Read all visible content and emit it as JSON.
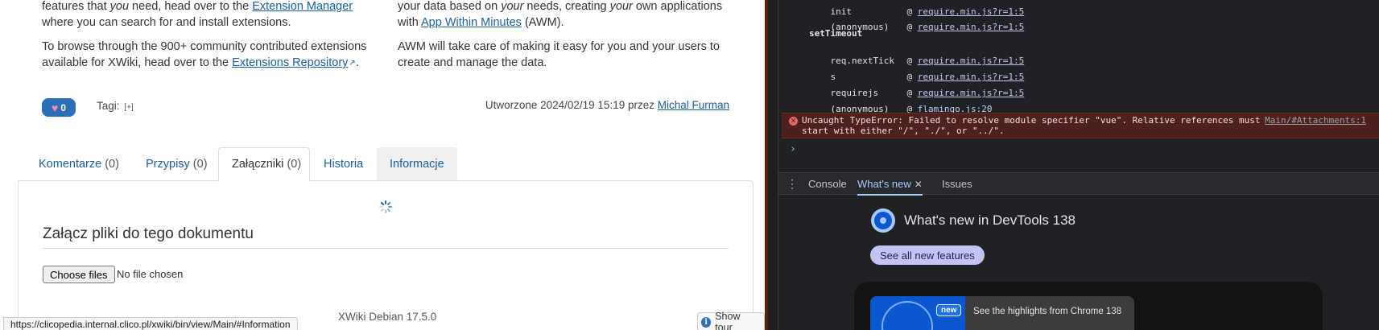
{
  "page": {
    "col_left": {
      "p1": {
        "pre": "features that ",
        "em": "you",
        "mid": " need, head over to the ",
        "link": "Extension Manager",
        "post": " where you can search for and install extensions."
      },
      "p2": {
        "pre": "To browse through the 900+ community contributed extensions available for XWiki, head over to the ",
        "link": "Extensions Repository",
        "post": "."
      }
    },
    "col_right": {
      "p1": {
        "pre": "your data based on ",
        "em": "your",
        "mid": " needs, creating ",
        "em2": "your",
        "mid2": " own applications with ",
        "link": "App Within Minutes",
        "post": " (AWM)."
      },
      "p2": "AWM will take care of making it easy for you and your users to create and manage the data."
    },
    "like_count": "0",
    "tags_label": "Tagi:",
    "tags_add": "[+]",
    "created": {
      "pre": "Utworzone 2024/02/19 15:19 przez ",
      "author": "Michal Furman"
    },
    "tabs": [
      {
        "label": "Komentarze",
        "count": "(0)"
      },
      {
        "label": "Przypisy",
        "count": "(0)"
      },
      {
        "label": "Załączniki",
        "count": "(0)"
      },
      {
        "label": "Historia",
        "count": ""
      },
      {
        "label": "Informacje",
        "count": ""
      }
    ],
    "attachments_title": "Załącz pliki do tego dokumentu",
    "choose_files": "Choose files",
    "no_file": "No file chosen",
    "footer_version": "XWiki Debian 17.5.0",
    "status_url": "https://clicopedia.internal.clico.pl/xwiki/bin/view/Main/#Information",
    "show_tour": "Show tour"
  },
  "devtools": {
    "stack_top": [
      {
        "fn": "init",
        "link": "require.min.js?r=1:5"
      },
      {
        "fn": "(anonymous)",
        "link": "require.min.js?r=1:5"
      }
    ],
    "async_label": "setTimeout",
    "stack_bottom": [
      {
        "fn": "req.nextTick",
        "link": "require.min.js?r=1:5"
      },
      {
        "fn": "s",
        "link": "require.min.js?r=1:5"
      },
      {
        "fn": "requirejs",
        "link": "require.min.js?r=1:5"
      },
      {
        "fn": "(anonymous)",
        "link": "flamingo.js:20"
      }
    ],
    "error_text": "Uncaught TypeError: Failed to resolve module specifier \"vue\". Relative references must start with either \"/\", \"./\", or \"../\".",
    "error_source": "Main/#Attachments:1",
    "prompt": "›",
    "drawer_tabs": [
      {
        "label": "Console"
      },
      {
        "label": "What's new"
      },
      {
        "label": "Issues"
      }
    ],
    "whats_new_title": "What's new in DevTools 138",
    "see_all": "See all new features",
    "highlight_badge": "new",
    "highlight_text": "See the highlights from Chrome 138"
  },
  "colors": {
    "link": "#1a5f9e",
    "like_button": "#2c6fb8",
    "devtools_bg": "#202124",
    "error_bg": "#4e2020",
    "accent_tab": "#a8c7fa",
    "see_all_button": "#c2c4f6"
  }
}
